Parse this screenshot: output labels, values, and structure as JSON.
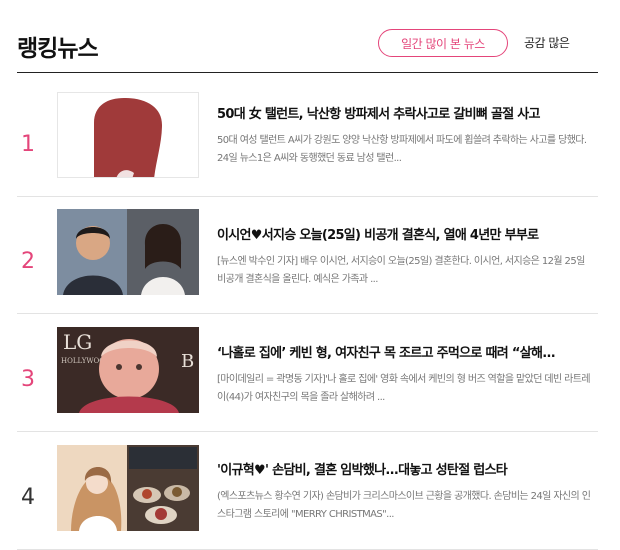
{
  "header": {
    "title": "랭킹뉴스",
    "tab_active": "일간 많이 본 뉴스",
    "tab_other": "공감 많은"
  },
  "news": [
    {
      "rank": "1",
      "headline": "50대 女 탤런트, 낙산항 방파제서 추락사고로 갈비뼈 골절 사고",
      "summary": "50대 여성 탤런트 A씨가 강원도 양양 낙산항 방파제에서 파도에 휩쓸려 추락하는 사고를 당했다. 24일 뉴스1은 A씨와 동행했던 동료 남성 탤런..."
    },
    {
      "rank": "2",
      "headline": "이시언♥서지승 오늘(25일) 비공개 결혼식, 열애 4년만 부부로",
      "summary": "[뉴스엔 박수인 기자] 배우 이시언, 서지승이 오늘(25일) 결혼한다. 이시언, 서지승은 12월 25일 비공개 결혼식을 올린다. 예식은 가족과 ..."
    },
    {
      "rank": "3",
      "headline": "‘나홀로 집에’ 케빈 형, 여자친구 목 조르고 주먹으로 때려 “살해...",
      "summary": "[마이데일리 = 곽명동 기자]'나 홀로 집에' 영화 속에서 케빈의 형 버즈 역할을 맡았던 데빈 라트레이(44)가 여자친구의 목을 졸라 살해하려 ..."
    },
    {
      "rank": "4",
      "headline": "'이규혁♥' 손담비, 결혼 임박했나...대놓고 성탄절 럽스타",
      "summary": "(엑스포츠뉴스 황수연 기자) 손담비가 크리스마스이브 근황을 공개했다. 손담비는 24일 자신의 인스타그램 스토리에 \"MERRY CHRISTMAS\"..."
    }
  ],
  "thumb_text": {
    "lg": "LG",
    "hollywood": "HOLLYWOOD",
    "b": "B"
  },
  "colors": {
    "accent": "#e4457a",
    "divider": "#222222",
    "summary_text": "#777777"
  }
}
